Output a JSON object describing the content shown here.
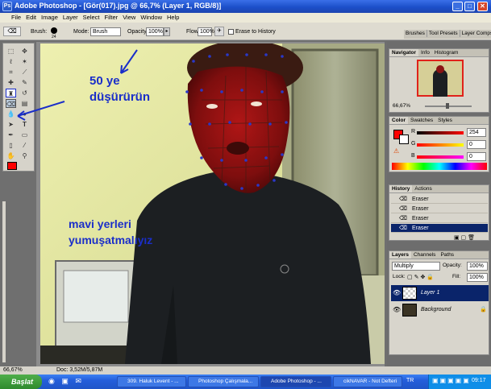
{
  "window": {
    "title": "Adobe Photoshop - [Gör(017).jpg @ 66,7% (Layer 1, RGB/8)]",
    "logo_text": "Ps",
    "minimize": "_",
    "maximize": "□",
    "close": "✕"
  },
  "menu": [
    "File",
    "Edit",
    "Image",
    "Layer",
    "Select",
    "Filter",
    "View",
    "Window",
    "Help"
  ],
  "options_bar": {
    "brush_label": "Brush:",
    "brush_size": "24",
    "mode_label": "Mode:",
    "mode_value": "Brush",
    "opacity_label": "Opacity:",
    "opacity_value": "100%",
    "flow_label": "Flow:",
    "flow_value": "100%",
    "erase_history": "Erase to History",
    "palette_tabs": [
      "Brushes",
      "Tool Presets",
      "Layer Comps"
    ]
  },
  "annotations": {
    "line1": "50 ye",
    "line2": "düşürürün",
    "line3": "mavi yerleri",
    "line4": "yumuşatmalıyız",
    "color": "#1a2ec9"
  },
  "navigator": {
    "tabs": [
      "Navigator",
      "Info",
      "Histogram"
    ],
    "zoom": "66,67%"
  },
  "color_panel": {
    "tabs": [
      "Color",
      "Swatches",
      "Styles"
    ],
    "r_label": "R",
    "g_label": "G",
    "b_label": "B",
    "r": "254",
    "g": "0",
    "b": "0",
    "foreground": "#fe0000"
  },
  "history": {
    "tabs": [
      "History",
      "Actions"
    ],
    "items": [
      "Eraser",
      "Eraser",
      "Eraser",
      "Eraser"
    ]
  },
  "layers": {
    "tabs": [
      "Layers",
      "Channels",
      "Paths"
    ],
    "blend_mode": "Multiply",
    "opacity_label": "Opacity:",
    "opacity_value": "100%",
    "lock_label": "Lock:",
    "fill_label": "Fill:",
    "fill_value": "100%",
    "items": [
      "Layer 1",
      "Background"
    ]
  },
  "status": {
    "zoom": "66,67%",
    "doc": "Doc: 3,52M/5,87M"
  },
  "taskbar": {
    "start": "Başlat",
    "tasks": [
      "309. Haluk Levent - ...",
      "Photoshop Çalışmala...",
      "Adobe Photoshop - ...",
      "cikNAVAR - Not Defteri"
    ],
    "lang": "TR",
    "clock": "09:17"
  }
}
